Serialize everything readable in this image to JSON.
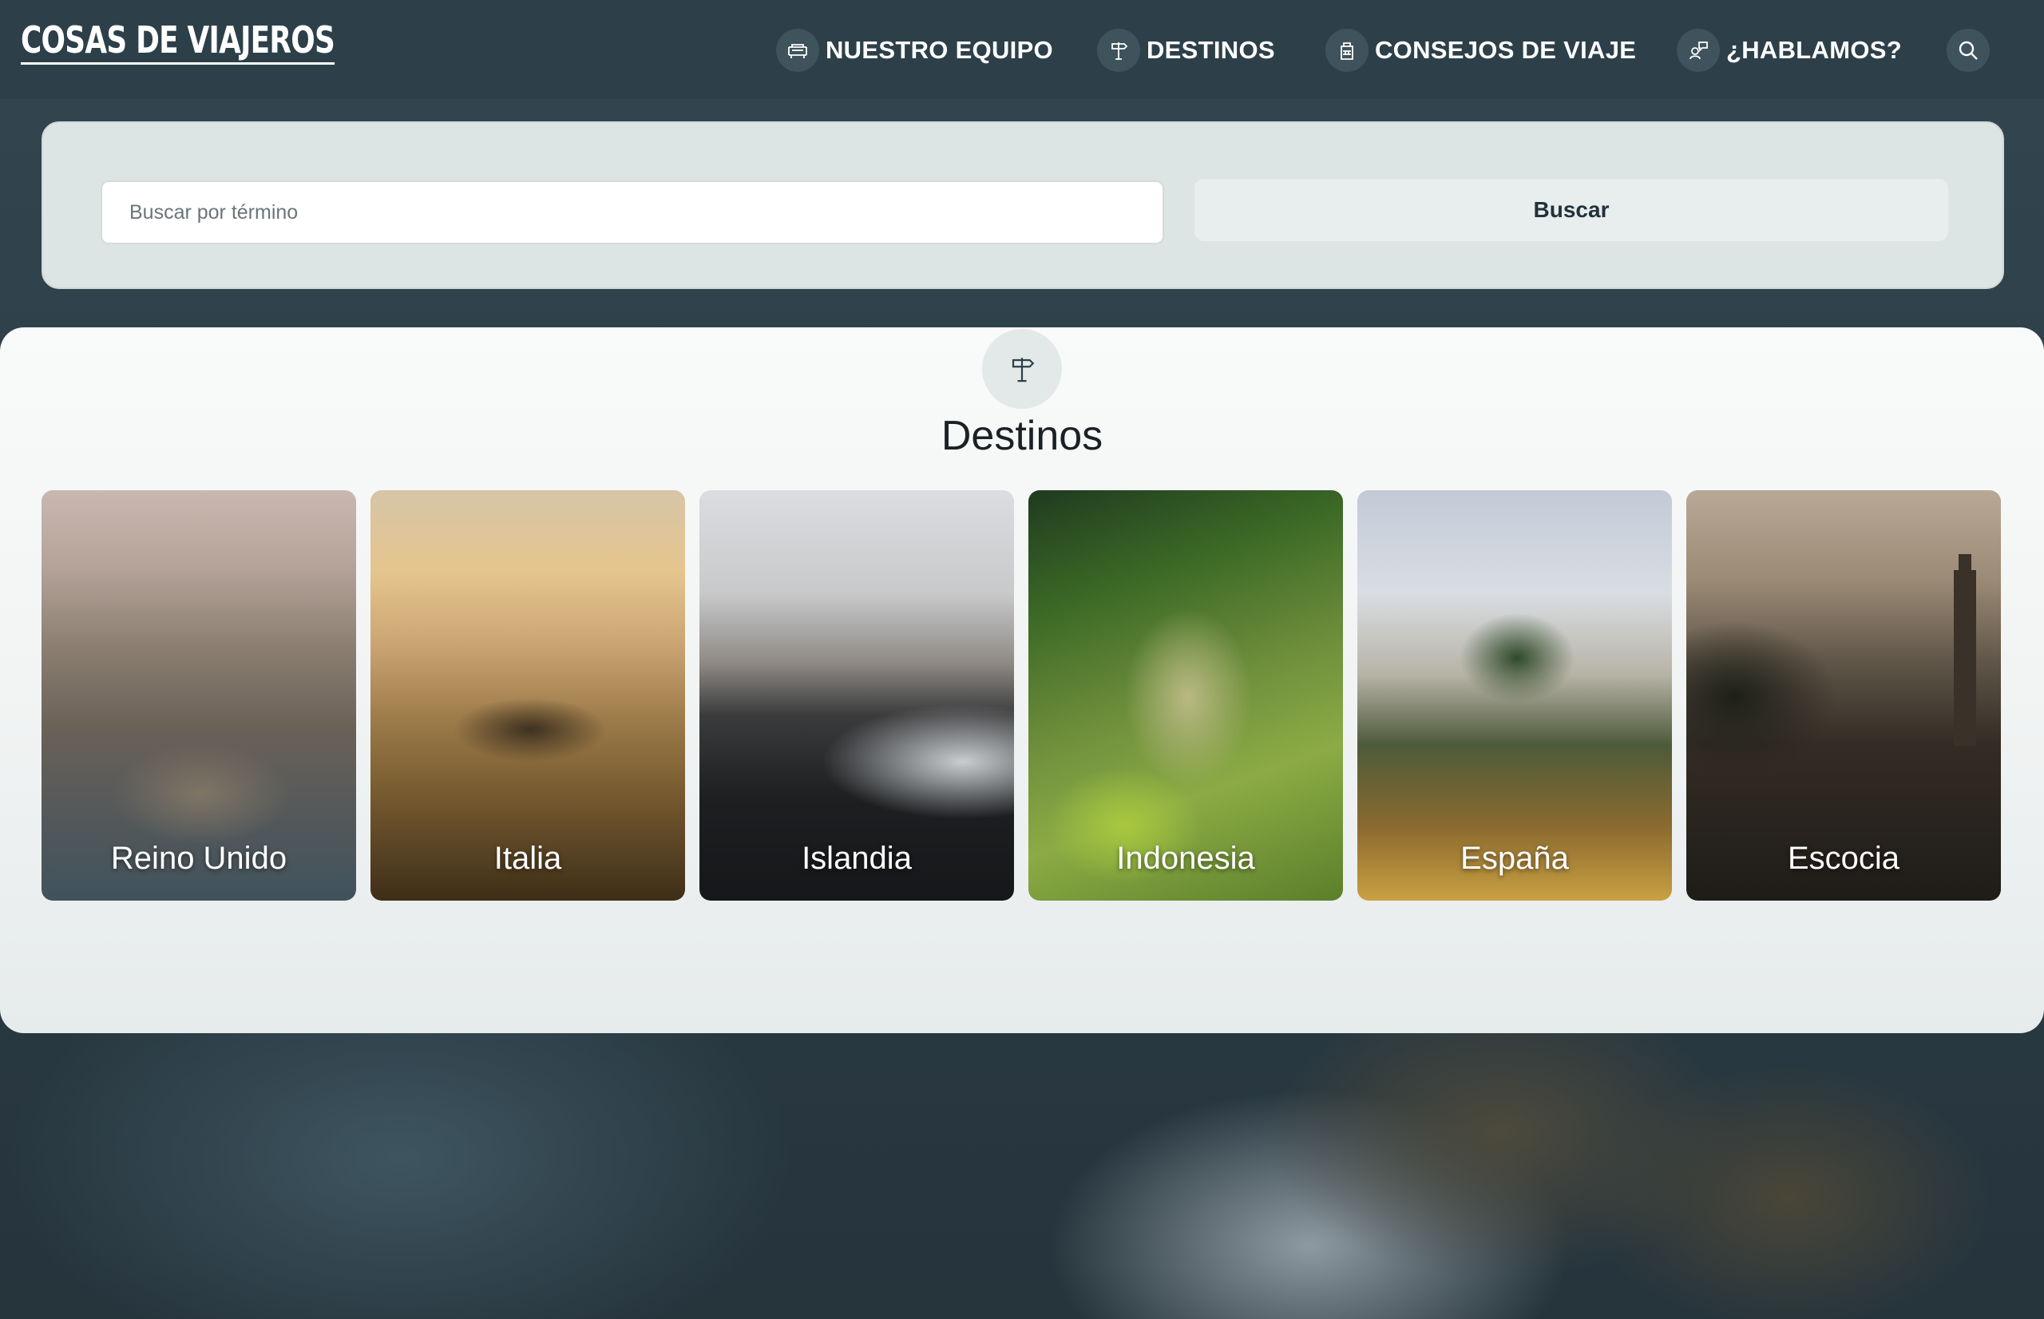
{
  "header": {
    "logo": "COSAS DE VIAJEROS",
    "nav": [
      {
        "label": "NUESTRO EQUIPO",
        "icon": "sofa-icon"
      },
      {
        "label": "DESTINOS",
        "icon": "signpost-icon"
      },
      {
        "label": "CONSEJOS DE VIAJE",
        "icon": "backpack-icon"
      },
      {
        "label": "¿HABLAMOS?",
        "icon": "chat-icon"
      }
    ],
    "search_icon": "search-icon"
  },
  "search": {
    "placeholder": "Buscar por término",
    "button_label": "Buscar"
  },
  "destinations": {
    "icon": "signpost-icon",
    "title": "Destinos",
    "items": [
      {
        "label": "Reino Unido"
      },
      {
        "label": "Italia"
      },
      {
        "label": "Islandia"
      },
      {
        "label": "Indonesia"
      },
      {
        "label": "España"
      },
      {
        "label": "Escocia"
      }
    ]
  },
  "colors": {
    "header_bg": "#2d4049",
    "accent_text": "#22323a",
    "panel_bg": "#dde4e4"
  }
}
